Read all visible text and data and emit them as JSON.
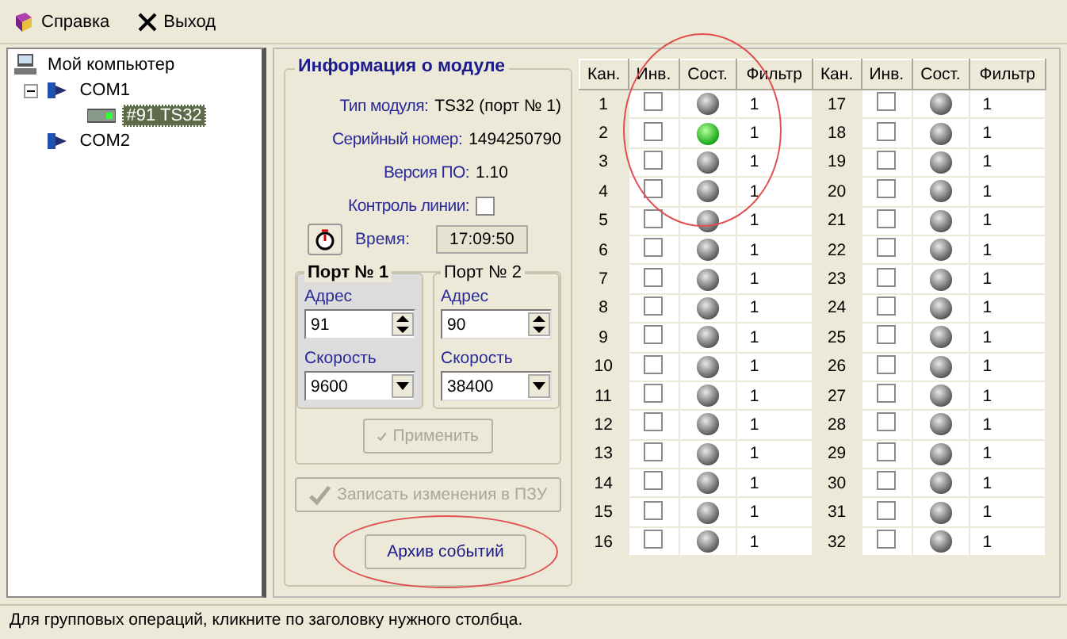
{
  "menu": [
    {
      "kind": "help",
      "label": "Справка"
    },
    {
      "kind": "exit",
      "label": "Выход"
    }
  ],
  "tree": {
    "label": "Мой компьютер",
    "children": [
      {
        "label": "COM1",
        "expanded": true,
        "children": [
          {
            "label": "#91 TS32",
            "selected": true
          }
        ]
      },
      {
        "label": "COM2"
      }
    ]
  },
  "module_info": {
    "title": "Информация о модуле",
    "fields": [
      {
        "label": "Тип модуля:",
        "value": "TS32 (порт № 1)"
      },
      {
        "label": "Серийный номер:",
        "value": "1494250790"
      },
      {
        "label": "Версия ПО:",
        "value": "1.10"
      }
    ],
    "line_control": {
      "label": "Контроль линии:",
      "checked": false
    },
    "time": {
      "label": "Время:",
      "value": "17:09:50"
    },
    "ports": [
      {
        "title": "Порт № 1",
        "selected": true,
        "address_label": "Адрес",
        "address": "91",
        "speed_label": "Скорость",
        "speed": "9600"
      },
      {
        "title": "Порт № 2",
        "selected": false,
        "address_label": "Адрес",
        "address": "90",
        "speed_label": "Скорость",
        "speed": "38400"
      }
    ],
    "apply_button": {
      "label": "Применить",
      "disabled": true
    },
    "write_button": {
      "label": "Записать изменения в ПЗУ",
      "disabled": true
    },
    "archive_button": {
      "label": "Архив событий",
      "disabled": false,
      "highlight": true
    }
  },
  "channel_table": {
    "highlight": true,
    "columns": [
      "Кан.",
      "Инв.",
      "Сост.",
      "Фильтр",
      "Кан.",
      "Инв.",
      "Сост.",
      "Фильтр"
    ],
    "channels": [
      {
        "number": "1",
        "inverted": false,
        "on": false,
        "filter": "1"
      },
      {
        "number": "2",
        "inverted": false,
        "on": true,
        "filter": "1"
      },
      {
        "number": "3",
        "inverted": false,
        "on": false,
        "filter": "1"
      },
      {
        "number": "4",
        "inverted": false,
        "on": false,
        "filter": "1"
      },
      {
        "number": "5",
        "inverted": false,
        "on": false,
        "filter": "1"
      },
      {
        "number": "6",
        "inverted": false,
        "on": false,
        "filter": "1"
      },
      {
        "number": "7",
        "inverted": false,
        "on": false,
        "filter": "1"
      },
      {
        "number": "8",
        "inverted": false,
        "on": false,
        "filter": "1"
      },
      {
        "number": "9",
        "inverted": false,
        "on": false,
        "filter": "1"
      },
      {
        "number": "10",
        "inverted": false,
        "on": false,
        "filter": "1"
      },
      {
        "number": "11",
        "inverted": false,
        "on": false,
        "filter": "1"
      },
      {
        "number": "12",
        "inverted": false,
        "on": false,
        "filter": "1"
      },
      {
        "number": "13",
        "inverted": false,
        "on": false,
        "filter": "1"
      },
      {
        "number": "14",
        "inverted": false,
        "on": false,
        "filter": "1"
      },
      {
        "number": "15",
        "inverted": false,
        "on": false,
        "filter": "1"
      },
      {
        "number": "16",
        "inverted": false,
        "on": false,
        "filter": "1"
      },
      {
        "number": "17",
        "inverted": false,
        "on": false,
        "filter": "1"
      },
      {
        "number": "18",
        "inverted": false,
        "on": false,
        "filter": "1"
      },
      {
        "number": "19",
        "inverted": false,
        "on": false,
        "filter": "1"
      },
      {
        "number": "20",
        "inverted": false,
        "on": false,
        "filter": "1"
      },
      {
        "number": "21",
        "inverted": false,
        "on": false,
        "filter": "1"
      },
      {
        "number": "22",
        "inverted": false,
        "on": false,
        "filter": "1"
      },
      {
        "number": "23",
        "inverted": false,
        "on": false,
        "filter": "1"
      },
      {
        "number": "24",
        "inverted": false,
        "on": false,
        "filter": "1"
      },
      {
        "number": "25",
        "inverted": false,
        "on": false,
        "filter": "1"
      },
      {
        "number": "26",
        "inverted": false,
        "on": false,
        "filter": "1"
      },
      {
        "number": "27",
        "inverted": false,
        "on": false,
        "filter": "1"
      },
      {
        "number": "28",
        "inverted": false,
        "on": false,
        "filter": "1"
      },
      {
        "number": "29",
        "inverted": false,
        "on": false,
        "filter": "1"
      },
      {
        "number": "30",
        "inverted": false,
        "on": false,
        "filter": "1"
      },
      {
        "number": "31",
        "inverted": false,
        "on": false,
        "filter": "1"
      },
      {
        "number": "32",
        "inverted": false,
        "on": false,
        "filter": "1"
      }
    ]
  },
  "status_bar": "Для групповых операций, кликните по заголовку нужного столбца."
}
